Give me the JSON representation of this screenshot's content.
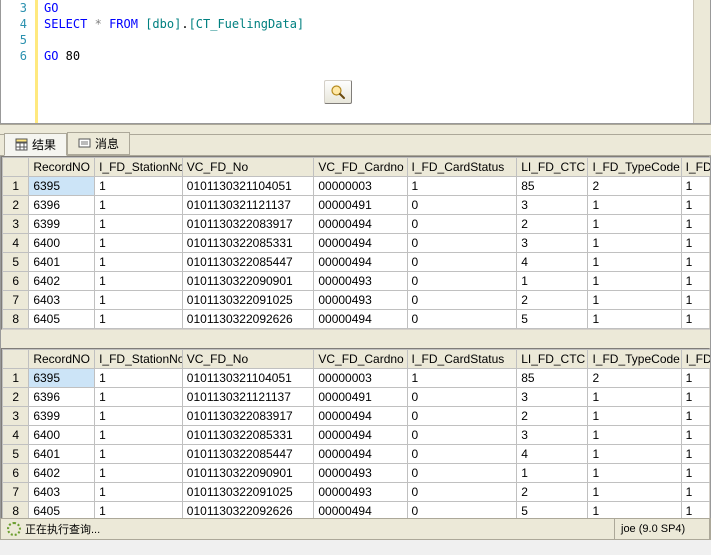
{
  "editor": {
    "lines": [
      {
        "no": 3,
        "tokens": [
          {
            "t": "GO",
            "cls": "kw"
          }
        ]
      },
      {
        "no": 4,
        "tokens": [
          {
            "t": "SELECT",
            "cls": "kw"
          },
          {
            "t": " "
          },
          {
            "t": "*",
            "cls": "star"
          },
          {
            "t": " "
          },
          {
            "t": "FROM",
            "cls": "kw"
          },
          {
            "t": " "
          },
          {
            "t": "[dbo]",
            "cls": "obj"
          },
          {
            "t": "."
          },
          {
            "t": "[CT_FuelingData]",
            "cls": "obj"
          }
        ]
      },
      {
        "no": 5,
        "tokens": []
      },
      {
        "no": 6,
        "tokens": [
          {
            "t": "GO",
            "cls": "kw"
          },
          {
            "t": " 80"
          }
        ]
      }
    ],
    "exec_icon": "magnifier-icon"
  },
  "tabs": {
    "results": "结果",
    "messages": "消息"
  },
  "columns": [
    "RecordNO",
    "I_FD_StationNo",
    "VC_FD_No",
    "VC_FD_Cardno",
    "I_FD_CardStatus",
    "LI_FD_CTC",
    "I_FD_TypeCode",
    "I_FD_Pum"
  ],
  "rows": [
    [
      "6395",
      "1",
      "0101130321104051",
      "00000003",
      "1",
      "85",
      "2",
      "1"
    ],
    [
      "6396",
      "1",
      "0101130321121137",
      "00000491",
      "0",
      "3",
      "1",
      "1"
    ],
    [
      "6399",
      "1",
      "0101130322083917",
      "00000494",
      "0",
      "2",
      "1",
      "1"
    ],
    [
      "6400",
      "1",
      "0101130322085331",
      "00000494",
      "0",
      "3",
      "1",
      "1"
    ],
    [
      "6401",
      "1",
      "0101130322085447",
      "00000494",
      "0",
      "4",
      "1",
      "1"
    ],
    [
      "6402",
      "1",
      "0101130322090901",
      "00000493",
      "0",
      "1",
      "1",
      "1"
    ],
    [
      "6403",
      "1",
      "0101130322091025",
      "00000493",
      "0",
      "2",
      "1",
      "1"
    ],
    [
      "6405",
      "1",
      "0101130322092626",
      "00000494",
      "0",
      "5",
      "1",
      "1"
    ]
  ],
  "status": {
    "running": "正在执行查询...",
    "user": "joe (9.0 SP4)"
  }
}
